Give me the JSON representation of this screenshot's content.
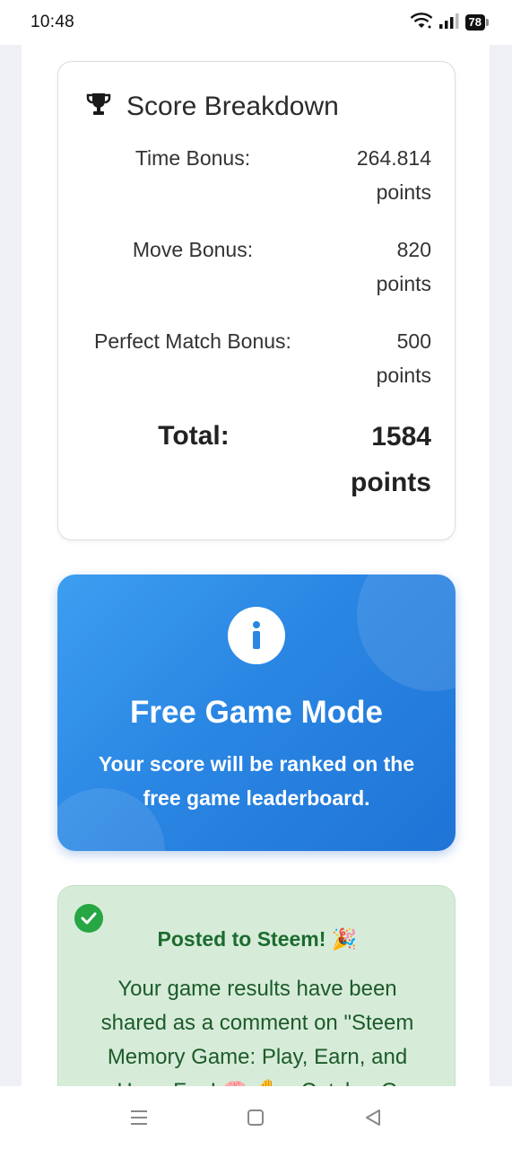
{
  "status_bar": {
    "time": "10:48",
    "battery": "78"
  },
  "score_breakdown": {
    "title": "Score Breakdown",
    "icon": "trophy-icon",
    "rows": [
      {
        "label": "Time Bonus:",
        "value_line1": "264.814",
        "value_line2": "points"
      },
      {
        "label": "Move Bonus:",
        "value_line1": "820",
        "value_line2": "points"
      },
      {
        "label": "Perfect Match Bonus:",
        "value_line1": "500",
        "value_line2": "points"
      }
    ],
    "total": {
      "label": "Total:",
      "value_line1": "1584",
      "value_line2": "points"
    }
  },
  "free_game": {
    "icon": "info-icon",
    "title": "Free Game Mode",
    "desc_line1": "Your score will be ranked on the",
    "desc_line2": "free game leaderboard.",
    "accent": "#2a86e3"
  },
  "posted": {
    "icon": "check-circle-icon",
    "title": "Posted to Steem! 🎉",
    "desc_line1": "Your game results have been",
    "desc_line2": "shared as a comment on \"Steem",
    "desc_line3": "Memory Game: Play, Earn, and",
    "desc_line4": "Have Fun! 🧠 ✋ - Catch a G",
    "accent": "#27a644"
  },
  "nav": {
    "icons": [
      "menu-icon",
      "home-icon",
      "back-icon"
    ]
  }
}
